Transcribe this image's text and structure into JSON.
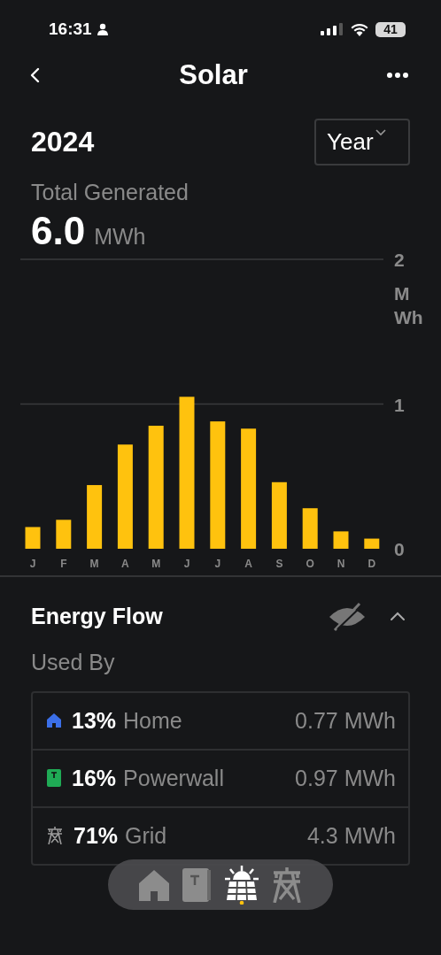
{
  "status_bar": {
    "time": "16:31",
    "battery": "41"
  },
  "nav": {
    "title": "Solar"
  },
  "period": {
    "year": "2024",
    "selector": "Year"
  },
  "total": {
    "label": "Total Generated",
    "value": "6.0",
    "unit": "MWh"
  },
  "chart": {
    "chart_data": {
      "type": "bar",
      "ylabel": "MWh",
      "categories": [
        "J",
        "F",
        "M",
        "A",
        "M",
        "J",
        "J",
        "A",
        "S",
        "O",
        "N",
        "D"
      ],
      "values": [
        0.15,
        0.2,
        0.44,
        0.72,
        0.85,
        1.05,
        0.88,
        0.83,
        0.46,
        0.28,
        0.12,
        0.07
      ],
      "ylim": [
        0,
        2
      ],
      "yticks": [
        0,
        1,
        2
      ]
    }
  },
  "energy_flow": {
    "title": "Energy Flow",
    "subtitle": "Used By",
    "expanded": true,
    "rows": [
      {
        "kind": "home",
        "percent": "13%",
        "name": "Home",
        "amount": "0.77 MWh",
        "color": "#3b6fe8"
      },
      {
        "kind": "powerwall",
        "percent": "16%",
        "name": "Powerwall",
        "amount": "0.97 MWh",
        "color": "#1faa55"
      },
      {
        "kind": "grid",
        "percent": "71%",
        "name": "Grid",
        "amount": "4.3 MWh",
        "color": "#9a9a9a"
      }
    ]
  },
  "tab_bar": [
    {
      "kind": "home",
      "selected": false
    },
    {
      "kind": "powerwall",
      "selected": false
    },
    {
      "kind": "solar",
      "selected": true
    },
    {
      "kind": "grid",
      "selected": false
    }
  ]
}
